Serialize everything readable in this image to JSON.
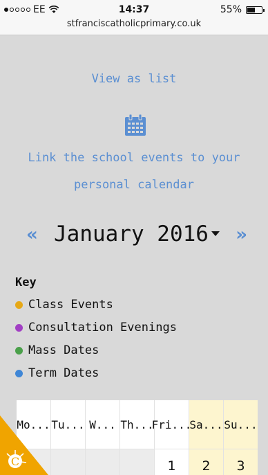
{
  "status": {
    "carrier": "EE",
    "time": "14:37",
    "battery": "55%",
    "battery_level": 0.55
  },
  "browser": {
    "url": "stfranciscatholicprimary.co.uk"
  },
  "links": {
    "view_as_list": "View as list",
    "link_line1": "Link the school events to your",
    "link_line2": "personal calendar"
  },
  "calendar_nav": {
    "prev": "«",
    "month": "January 2016",
    "next": "»"
  },
  "key": {
    "title": "Key",
    "items": [
      {
        "label": "Class Events",
        "color": "#e6a817"
      },
      {
        "label": "Consultation Evenings",
        "color": "#a23fc4"
      },
      {
        "label": "Mass Dates",
        "color": "#4aa04a"
      },
      {
        "label": "Term Dates",
        "color": "#3f86d6"
      }
    ]
  },
  "grid": {
    "days": [
      "Mo...",
      "Tu...",
      "W...",
      "Th...",
      "Fri...",
      "Sa...",
      "Su..."
    ],
    "first_row": [
      "",
      "",
      "",
      "",
      "1",
      "2",
      "3"
    ]
  },
  "colors": {
    "link_blue": "#5b8fd2",
    "weekend_bg": "#fdf5cf",
    "badge_orange": "#f0a400"
  },
  "badge": {
    "letter": "C"
  }
}
